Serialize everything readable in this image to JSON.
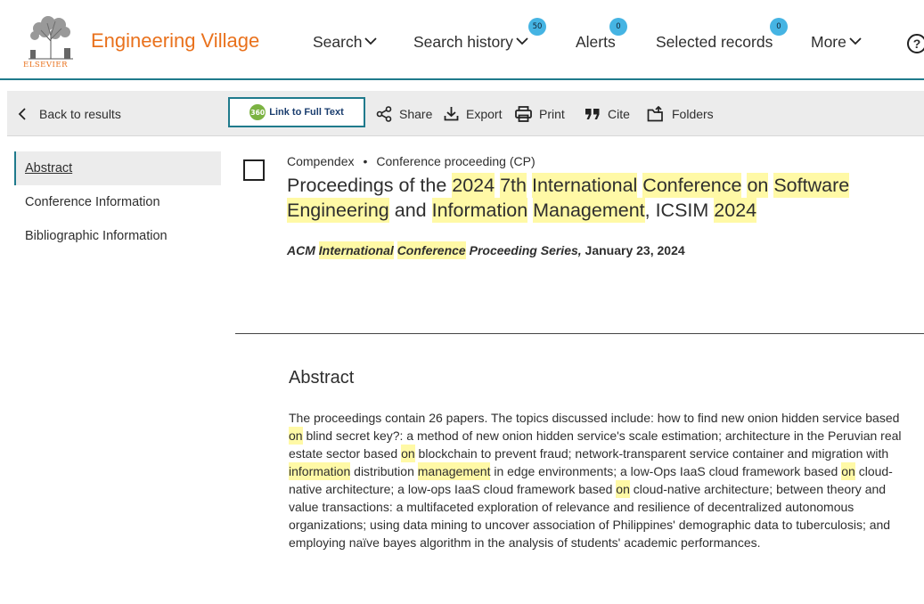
{
  "header": {
    "brand": "Engineering Village",
    "logo_text": "ELSEVIER",
    "nav": {
      "search": "Search",
      "search_history": "Search history",
      "search_history_count": "50",
      "alerts": "Alerts",
      "alerts_count": "0",
      "selected_records": "Selected records",
      "selected_records_count": "0",
      "more": "More"
    },
    "help_symbol": "?"
  },
  "toolbar": {
    "back": "Back to results",
    "fulltext_badge": "360",
    "fulltext": "Link to Full Text",
    "share": "Share",
    "export": "Export",
    "print": "Print",
    "cite": "Cite",
    "folders": "Folders"
  },
  "sidenav": {
    "items": [
      {
        "label": "Abstract"
      },
      {
        "label": "Conference Information"
      },
      {
        "label": "Bibliographic Information"
      }
    ]
  },
  "record": {
    "database": "Compendex",
    "separator": "•",
    "doc_type": "Conference proceeding (CP)",
    "title_tokens": [
      {
        "text": "Proceedings of the ",
        "hl": false
      },
      {
        "text": "2024",
        "hl": true
      },
      {
        "text": " ",
        "hl": false
      },
      {
        "text": "7th",
        "hl": true
      },
      {
        "text": " ",
        "hl": false
      },
      {
        "text": "International",
        "hl": true
      },
      {
        "text": " ",
        "hl": false
      },
      {
        "text": "Conference",
        "hl": true
      },
      {
        "text": " ",
        "hl": false
      },
      {
        "text": "on",
        "hl": true
      },
      {
        "text": " ",
        "hl": false
      },
      {
        "text": "Software",
        "hl": true
      },
      {
        "text": " ",
        "hl": false
      },
      {
        "text": "Engineering",
        "hl": true
      },
      {
        "text": " and ",
        "hl": false
      },
      {
        "text": "Information",
        "hl": true
      },
      {
        "text": " ",
        "hl": false
      },
      {
        "text": "Management",
        "hl": true
      },
      {
        "text": ", ICSIM ",
        "hl": false
      },
      {
        "text": "2024",
        "hl": true
      }
    ],
    "source": {
      "journal_prefix": "ACM ",
      "journal_hl_1": "International",
      "journal_space": " ",
      "journal_hl_2": "Conference",
      "journal_suffix": " Proceeding Series,",
      "date": " January 23, 2024"
    },
    "abstract_heading": "Abstract",
    "abstract_tokens": [
      {
        "text": "The proceedings contain 26 papers. The topics discussed include: how to find new onion hidden service based ",
        "hl": false
      },
      {
        "text": "on",
        "hl": true
      },
      {
        "text": " blind secret key?: a method of new onion hidden service's scale estimation; architecture in the Peruvian real estate sector based ",
        "hl": false
      },
      {
        "text": "on",
        "hl": true
      },
      {
        "text": " blockchain to prevent fraud; network-transparent service container and migration with ",
        "hl": false
      },
      {
        "text": "information",
        "hl": true
      },
      {
        "text": " distribution ",
        "hl": false
      },
      {
        "text": "management",
        "hl": true
      },
      {
        "text": " in edge environments; a low-Ops IaaS cloud framework based ",
        "hl": false
      },
      {
        "text": "on",
        "hl": true
      },
      {
        "text": " cloud-native architecture; a low-ops IaaS cloud framework based ",
        "hl": false
      },
      {
        "text": "on",
        "hl": true
      },
      {
        "text": " cloud-native architecture; between theory and value transactions: a multifaceted exploration of relevance and resilience of decentralized autonomous organizations; using data mining to uncover association of Philippines' demographic data to tuberculosis; and employing naïve bayes algorithm in the analysis of students' academic performances.",
        "hl": false
      }
    ]
  },
  "colors": {
    "brand": "#e9711c",
    "accent": "#1f7a8c",
    "badge": "#45b4e3",
    "highlight": "#fff9a6",
    "toolbar_bg": "#ececec"
  },
  "icons": [
    "tree-logo-icon",
    "chevron-down-icon",
    "help-icon",
    "chevron-left-icon",
    "share-icon",
    "export-icon",
    "print-icon",
    "cite-icon",
    "folder-icon"
  ]
}
